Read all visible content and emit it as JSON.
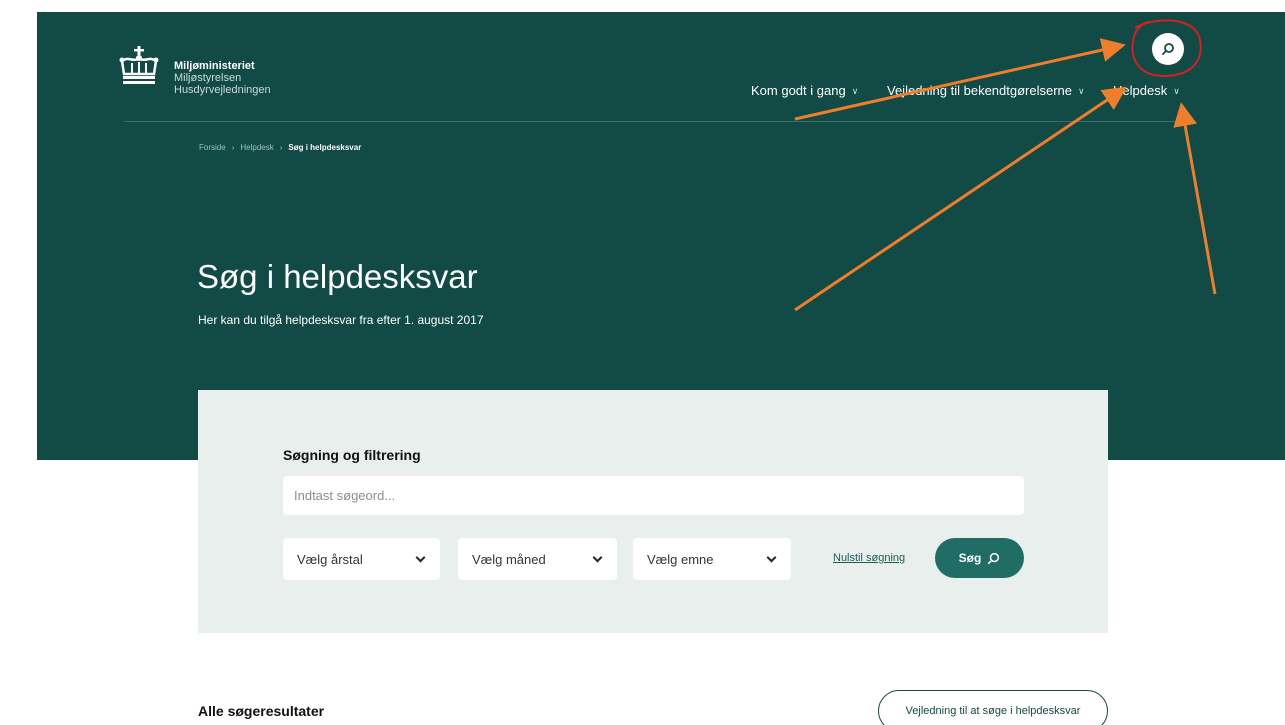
{
  "header": {
    "org_name": "Miljøministeriet",
    "org_sub1": "Miljøstyrelsen",
    "org_sub2": "Husdyrvejledningen",
    "nav": [
      {
        "label": "Kom godt i gang"
      },
      {
        "label": "Vejledning til bekendtgørelserne"
      },
      {
        "label": "Helpdesk"
      }
    ],
    "icons": {
      "search": "search-icon",
      "dropdown": "chevron-down-icon",
      "logo": "crown-logo"
    }
  },
  "breadcrumb": {
    "items": [
      "Forside",
      "Helpdesk"
    ],
    "current": "Søg i helpdesksvar",
    "separator": "›"
  },
  "hero": {
    "title": "Søg i helpdesksvar",
    "subtitle": "Her kan du tilgå helpdesksvar fra efter 1. august 2017"
  },
  "search": {
    "heading": "Søgning og filtrering",
    "placeholder": "Indtast søgeord...",
    "value": "",
    "year_select": "Vælg årstal",
    "month_select": "Vælg måned",
    "topic_select": "Vælg emne",
    "reset_label": "Nulstil søgning",
    "submit_label": "Søg"
  },
  "results": {
    "heading": "Alle søgeresultater",
    "guide_label": "Vejledning til at søge i helpdesksvar"
  },
  "colors": {
    "hero_bg": "#124a45",
    "panel_bg": "#e8efed",
    "accent_button": "#1f6d64",
    "annotation_arrow": "#f07d2b",
    "annotation_circle": "#d42020"
  }
}
